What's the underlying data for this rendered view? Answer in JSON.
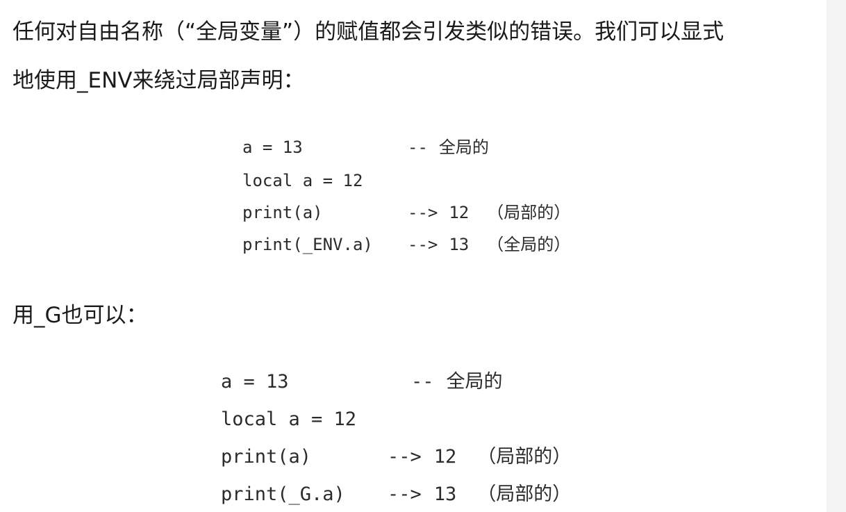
{
  "paragraphs": {
    "p1_line1": "任何对自由名称（“全局变量”）的赋值都会引发类似的错误。我们可以显式",
    "p1_line2": "地使用_ENV来绕过局部声明：",
    "p2": "用_G也可以："
  },
  "code_block_1": {
    "lines": [
      {
        "code": "a = 13",
        "arrow": "--",
        "value": "",
        "note": "全局的"
      },
      {
        "code": "local a = 12",
        "arrow": "",
        "value": "",
        "note": ""
      },
      {
        "code": "print(a)",
        "arrow": "-->",
        "value": "12",
        "note": "（局部的）"
      },
      {
        "code": "print(_ENV.a)",
        "arrow": "-->",
        "value": "13",
        "note": "（全局的）"
      }
    ]
  },
  "code_block_2": {
    "lines": [
      {
        "code": "a = 13",
        "arrow": "--",
        "value": "",
        "note": "全局的"
      },
      {
        "code": "local a = 12",
        "arrow": "",
        "value": "",
        "note": ""
      },
      {
        "code": "print(a)",
        "arrow": "-->",
        "value": "12",
        "note": "（局部的）"
      },
      {
        "code": "print(_G.a)",
        "arrow": "-->",
        "value": "13",
        "note": "（局部的）"
      }
    ]
  }
}
